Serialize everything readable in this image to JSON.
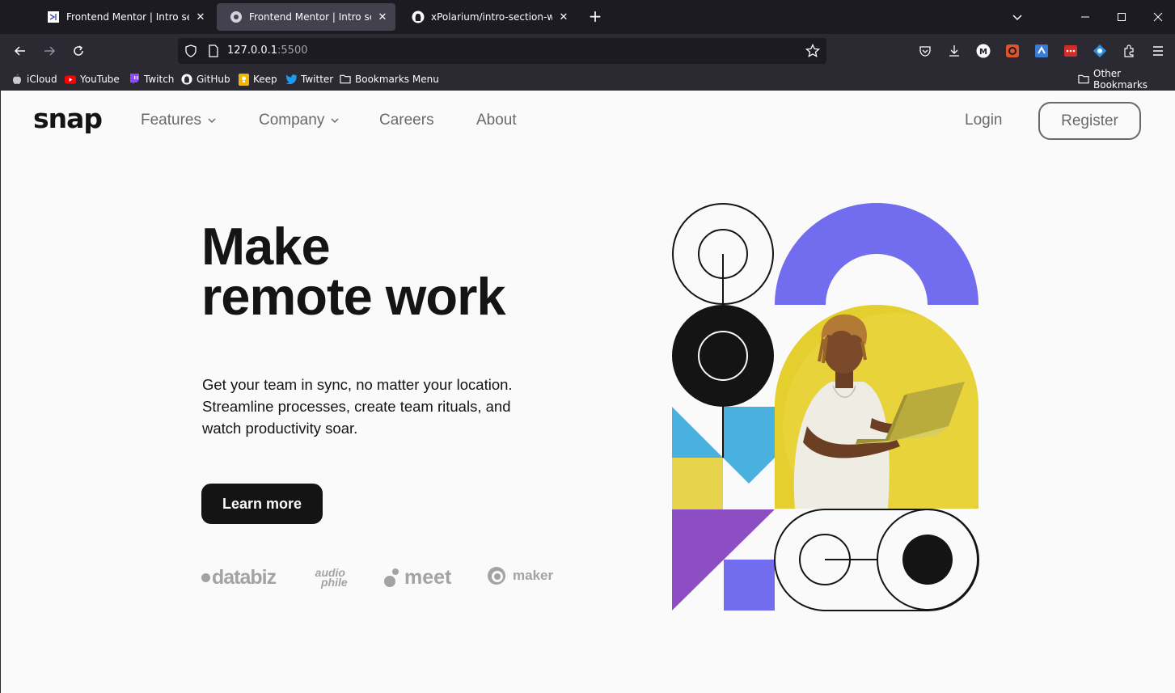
{
  "browser": {
    "tabs": [
      {
        "title": "Frontend Mentor | Intro section",
        "active": false,
        "favicon": "frontend-mentor-icon"
      },
      {
        "title": "Frontend Mentor | Intro section",
        "active": true,
        "favicon": "globe-icon"
      },
      {
        "title": "xPolarium/intro-section-with-d",
        "active": false,
        "favicon": "github-icon"
      }
    ],
    "url": {
      "host": "127.0.0.1",
      "port": ":5500"
    },
    "bookmarks": [
      {
        "label": "iCloud",
        "icon": "apple-icon"
      },
      {
        "label": "YouTube",
        "icon": "youtube-icon"
      },
      {
        "label": "Twitch",
        "icon": "twitch-icon"
      },
      {
        "label": "GitHub",
        "icon": "github-icon"
      },
      {
        "label": "Keep",
        "icon": "keep-icon"
      },
      {
        "label": "Twitter",
        "icon": "twitter-icon"
      },
      {
        "label": "Bookmarks Menu",
        "icon": "folder-icon"
      }
    ],
    "other_bookmarks": "Other Bookmarks",
    "colors": {
      "tabbar": "#1c1b22",
      "toolbar": "#2b2a33",
      "text": "#fbfbfe"
    }
  },
  "site": {
    "logo": "snap",
    "nav": {
      "features": "Features",
      "company": "Company",
      "careers": "Careers",
      "about": "About",
      "login": "Login",
      "register": "Register"
    },
    "hero": {
      "title_line1": "Make",
      "title_line2": "remote work",
      "text": "Get your team in sync, no matter your location. Streamline processes, create team rituals, and watch productivity soar.",
      "cta": "Learn more"
    },
    "clients": {
      "databiz": "databiz",
      "audiophile_top": "audio",
      "audiophile_bottom": "phile",
      "meet": "meet",
      "maker": "maker"
    },
    "colors": {
      "almost_black": "#141414",
      "medium_gray": "#696969",
      "purple": "#726cee",
      "yellow": "#e7d34c",
      "blue": "#4ab0dd",
      "violet": "#8d4ec3"
    }
  }
}
